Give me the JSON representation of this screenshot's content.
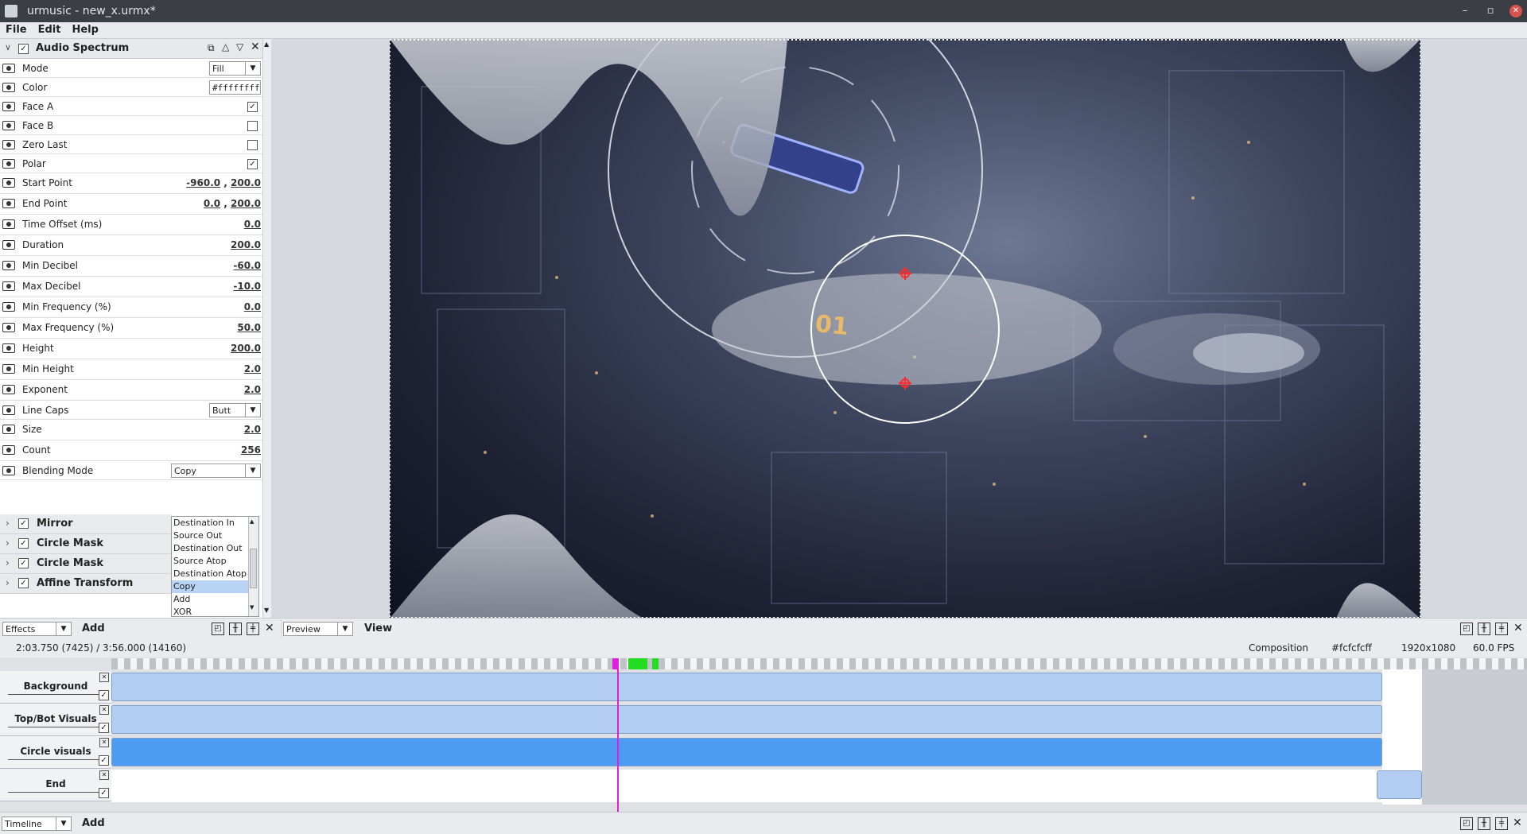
{
  "window": {
    "title": "urmusic - new_x.urmx*"
  },
  "menu": [
    "File",
    "Edit",
    "Help"
  ],
  "effect": {
    "name": "Audio Spectrum",
    "properties": [
      {
        "label": "Mode",
        "type": "dropdown",
        "value": "Fill"
      },
      {
        "label": "Color",
        "type": "color",
        "value": "#ffffffff"
      },
      {
        "label": "Face A",
        "type": "checkbox",
        "checked": true
      },
      {
        "label": "Face B",
        "type": "checkbox",
        "checked": false
      },
      {
        "label": "Zero Last",
        "type": "checkbox",
        "checked": false
      },
      {
        "label": "Polar",
        "type": "checkbox",
        "checked": true
      },
      {
        "label": "Start Point",
        "type": "pair",
        "value": [
          "-960.0",
          "200.0"
        ]
      },
      {
        "label": "End Point",
        "type": "pair",
        "value": [
          "0.0",
          "200.0"
        ]
      },
      {
        "label": "Time Offset (ms)",
        "type": "number",
        "value": "0.0"
      },
      {
        "label": "Duration",
        "type": "number",
        "value": "200.0"
      },
      {
        "label": "Min Decibel",
        "type": "number",
        "value": "-60.0"
      },
      {
        "label": "Max Decibel",
        "type": "number",
        "value": "-10.0"
      },
      {
        "label": "Min Frequency (%)",
        "type": "number",
        "value": "0.0"
      },
      {
        "label": "Max Frequency (%)",
        "type": "number",
        "value": "50.0"
      },
      {
        "label": "Height",
        "type": "number",
        "value": "200.0"
      },
      {
        "label": "Min Height",
        "type": "number",
        "value": "2.0"
      },
      {
        "label": "Exponent",
        "type": "number",
        "value": "2.0"
      },
      {
        "label": "Line Caps",
        "type": "dropdown",
        "value": "Butt"
      },
      {
        "label": "Size",
        "type": "number",
        "value": "2.0"
      },
      {
        "label": "Count",
        "type": "number",
        "value": "256"
      },
      {
        "label": "Blending Mode",
        "type": "dropdown",
        "value": "Copy"
      }
    ]
  },
  "blend_options": [
    "Destination In",
    "Source Out",
    "Destination Out",
    "Source Atop",
    "Destination Atop",
    "Copy",
    "Add",
    "XOR"
  ],
  "blend_selected": "Copy",
  "sub_effects": [
    {
      "name": "Mirror",
      "checked": true
    },
    {
      "name": "Circle Mask",
      "checked": true
    },
    {
      "name": "Circle Mask",
      "checked": true
    },
    {
      "name": "Affine Transform",
      "checked": true
    }
  ],
  "left_bottom": {
    "dropdown": "Effects",
    "add": "Add"
  },
  "preview_bottom": {
    "dropdown": "Preview",
    "view": "View"
  },
  "canvas_text": "01",
  "info": {
    "time": "2:03.750 (7425)  /  3:56.000 (14160)",
    "composition": "Composition",
    "bg_color": "#fcfcfcff",
    "resolution": "1920x1080",
    "fps": "60.0 FPS"
  },
  "playhead_fraction": 0.36,
  "tracks": [
    "Background",
    "Top/Bot Visuals",
    "Circle visuals",
    "End"
  ],
  "timeline_bottom": {
    "dropdown": "Timeline",
    "add": "Add"
  },
  "colors": {
    "clip": "#b3cdf2",
    "clip_active": "#4d9bf2",
    "playhead": "#e020e0",
    "marker": "#22dd22"
  }
}
